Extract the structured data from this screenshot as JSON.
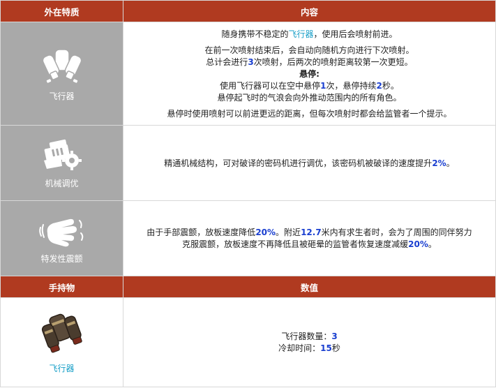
{
  "header1": {
    "col1": "外在特质",
    "col2": "内容"
  },
  "traits": [
    {
      "name": "飞行器",
      "icon": "jetpack-icon",
      "lines": {
        "l1_pre": "随身携带不稳定的",
        "l1_link": "飞行器",
        "l1_post": "，使用后会喷射前进。",
        "l2": "在前一次喷射结束后，会自动向随机方向进行下次喷射。",
        "l3_pre": "总计会进行",
        "l3_num": "3",
        "l3_post": "次喷射，后两次的喷射距离较第一次更短。",
        "l4": "悬停:",
        "l5_pre": "使用飞行器可以在空中悬停",
        "l5_num1": "1",
        "l5_mid": "次，悬停持续",
        "l5_num2": "2",
        "l5_post": "秒。",
        "l6": "悬停起飞时的气浪会向外推动范围内的所有角色。",
        "l7": "悬停时使用喷射可以前进更远的距离，但每次喷射时都会给监管者一个提示。"
      }
    },
    {
      "name": "机械调优",
      "icon": "gear-machine-icon",
      "lines": {
        "l1_pre": "精通机械结构，可对破译的密码机进行调优，该密码机被破译的速度提升",
        "l1_num": "2%",
        "l1_post": "。"
      }
    },
    {
      "name": "特发性震颤",
      "icon": "shaking-hand-icon",
      "lines": {
        "l1_pre": "由于手部震颤，放板速度降低",
        "l1_num1": "20%",
        "l1_mid": "。附近",
        "l1_num2": "12.7",
        "l1_post": "米内有求生者时，会为了周围的同伴努力",
        "l2_pre": "克服震颤，放板速度不再降低且被砸晕的监管者恢复速度减缓",
        "l2_num": "20%",
        "l2_post": "。"
      }
    }
  ],
  "header2": {
    "col1": "手持物",
    "col2": "数值"
  },
  "item": {
    "name": "飞行器",
    "icon": "jetpack-item-icon",
    "count_label": "飞行器数量：",
    "count_value": "3",
    "cd_label": "冷却时间：",
    "cd_value": "15",
    "cd_unit": "秒"
  },
  "colors": {
    "header_bg": "#b03a20",
    "trait_bg": "#a9a9a9",
    "link": "#1aa0c8",
    "number": "#1a3fd0"
  }
}
